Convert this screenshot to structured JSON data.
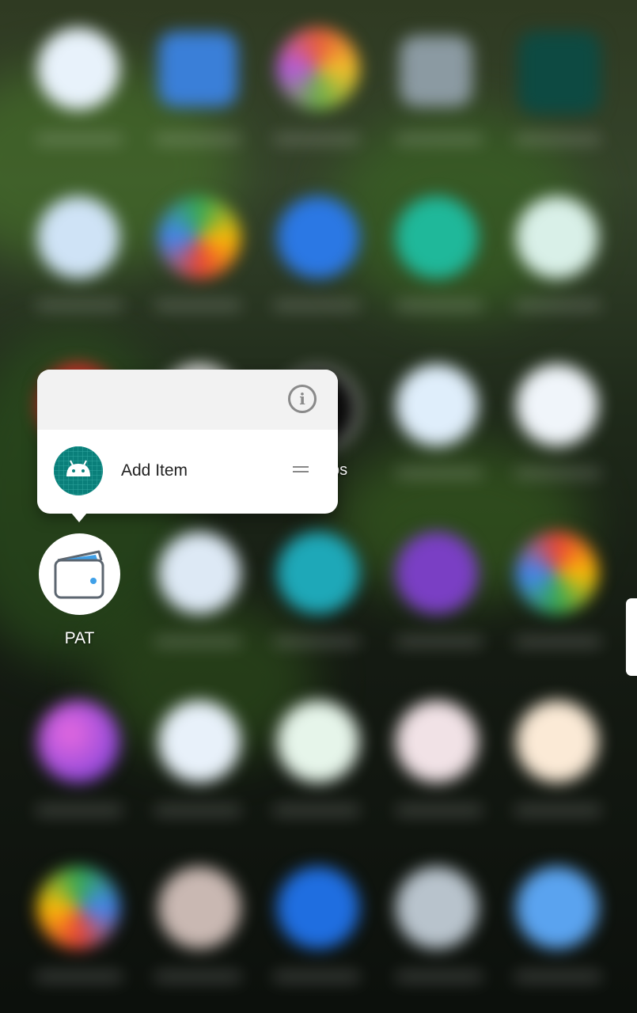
{
  "popup": {
    "info_icon": "info-icon",
    "shortcut": {
      "label": "Add Item",
      "icon": "android-icon",
      "handle_icon": "drag-handle-icon"
    }
  },
  "focused_app": {
    "name": "PAT",
    "icon": "wallet-icon"
  },
  "partial_label": "os",
  "colors": {
    "popup_header": "#f2f2f2",
    "popup_body": "#ffffff",
    "shortcut_icon_bg": "#0a7f7a",
    "wallet_stroke": "#5c6670",
    "wallet_accent": "#3fa0e8"
  }
}
